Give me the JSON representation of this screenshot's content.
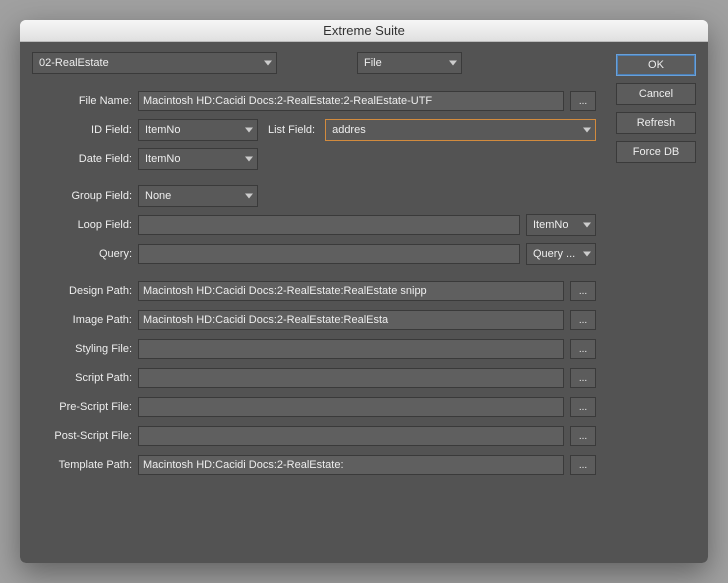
{
  "window": {
    "title": "Extreme Suite"
  },
  "top": {
    "preset": "02-RealEstate",
    "mode": "File"
  },
  "buttons": {
    "ok": "OK",
    "cancel": "Cancel",
    "refresh": "Refresh",
    "forcedb": "Force DB",
    "browse": "..."
  },
  "labels": {
    "fileName": "File Name:",
    "idField": "ID Field:",
    "listField": "List Field:",
    "dateField": "Date Field:",
    "groupField": "Group Field:",
    "loopField": "Loop Field:",
    "query": "Query:",
    "designPath": "Design Path:",
    "imagePath": "Image Path:",
    "stylingFile": "Styling File:",
    "scriptPath": "Script Path:",
    "preScript": "Pre-Script File:",
    "postScript": "Post-Script File:",
    "templatePath": "Template Path:"
  },
  "values": {
    "fileName": "Macintosh HD:Cacidi Docs:2-RealEstate:2-RealEstate-UTF",
    "idField": "ItemNo",
    "listField": "addres",
    "dateField": "ItemNo",
    "groupField": "None",
    "loopField": "",
    "loopDropdown": "ItemNo",
    "query": "",
    "queryDropdown": "Query ...",
    "designPath": "Macintosh HD:Cacidi Docs:2-RealEstate:RealEstate snipp",
    "imagePath": "Macintosh HD:Cacidi Docs:2-RealEstate:RealEsta",
    "stylingFile": "",
    "scriptPath": "",
    "preScript": "",
    "postScript": "",
    "templatePath": "Macintosh HD:Cacidi Docs:2-RealEstate:"
  }
}
